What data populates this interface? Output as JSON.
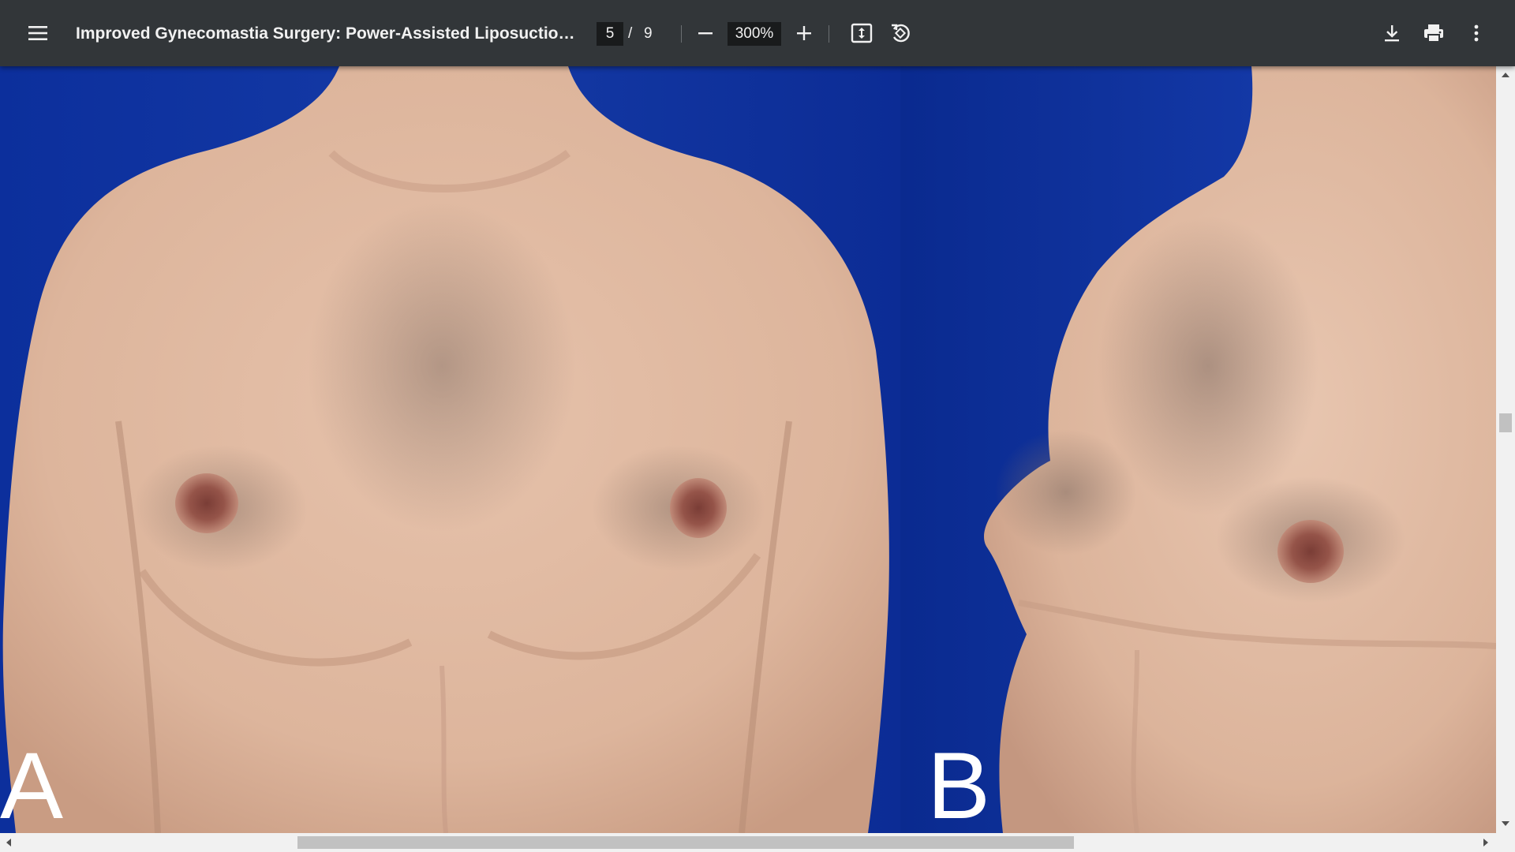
{
  "toolbar": {
    "menu_icon": "hamburger-menu-icon",
    "title": "Improved Gynecomastia Surgery: Power-Assisted Liposuction Wi...",
    "page_current": "5",
    "page_separator": "/",
    "page_total": "9",
    "zoom_out_icon": "minus-icon",
    "zoom_level": "300%",
    "zoom_in_icon": "plus-icon",
    "fit_icon": "fit-to-page-icon",
    "rotate_icon": "rotate-counterclockwise-icon",
    "download_icon": "download-icon",
    "print_icon": "print-icon",
    "more_icon": "more-vertical-icon"
  },
  "figure": {
    "panel_a_label": "A",
    "panel_b_label": "B"
  },
  "colors": {
    "toolbar_bg": "#323639",
    "backdrop_blue": "#1338a6",
    "skin": "#e0b8a0",
    "areola": "#9a5a4e",
    "scrollbar_track": "#f1f1f1",
    "scrollbar_thumb": "#c1c1c1"
  }
}
